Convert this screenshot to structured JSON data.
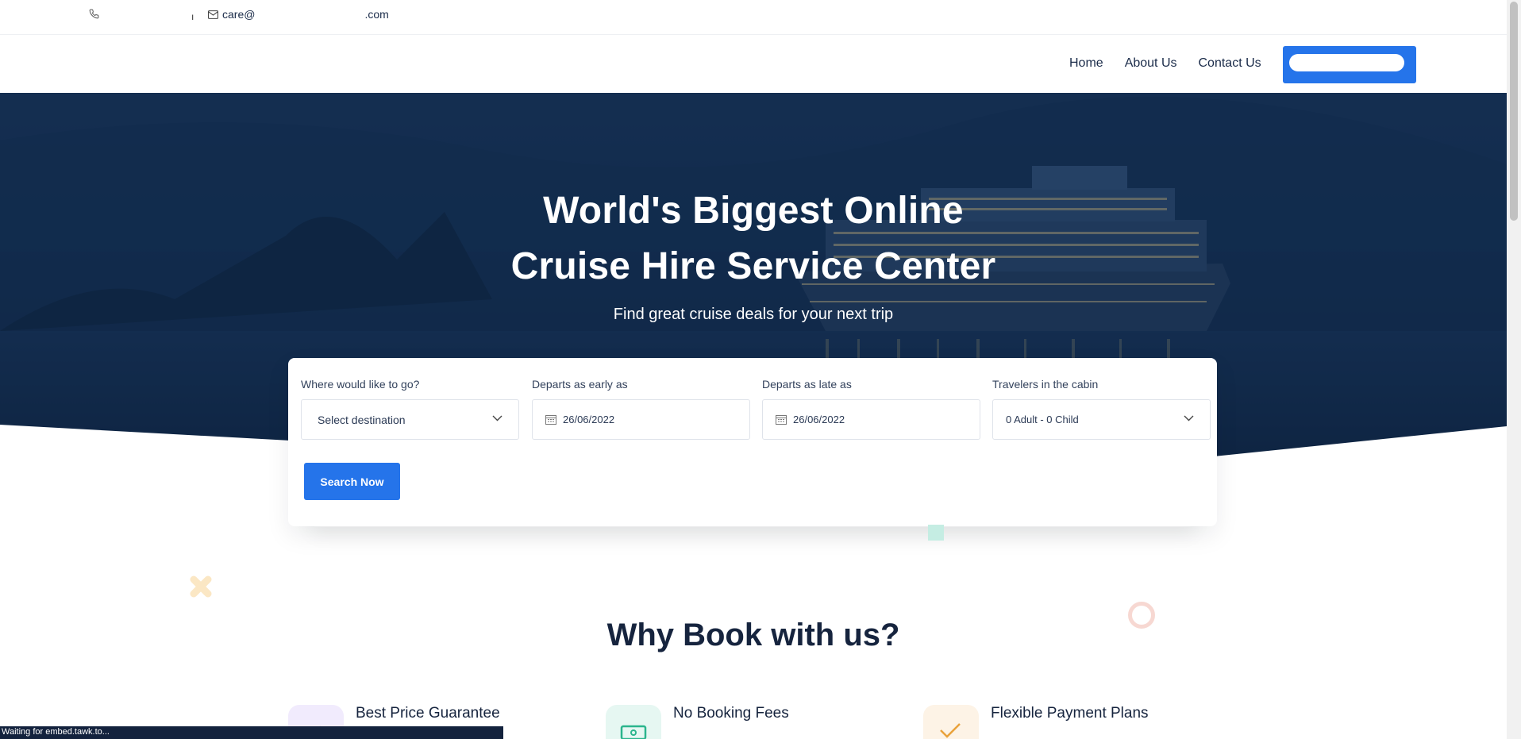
{
  "topbar": {
    "phone_text": "",
    "email_prefix": "care@",
    "email_suffix": ".com"
  },
  "nav": {
    "links": [
      "Home",
      "About Us",
      "Contact Us"
    ]
  },
  "hero": {
    "title_line1": "World's Biggest Online",
    "title_line2": "Cruise Hire Service Center",
    "subtitle": "Find great cruise deals for your next trip"
  },
  "search": {
    "destination_label": "Where would like to go?",
    "destination_value": "Select destination",
    "early_label": "Departs as early as",
    "early_value": "26/06/2022",
    "late_label": "Departs as late as",
    "late_value": "26/06/2022",
    "travelers_label": "Travelers in the cabin",
    "travelers_value": "0 Adult - 0 Child",
    "button": "Search Now"
  },
  "why": {
    "title": "Why Book with us?",
    "features": [
      {
        "title": "Best Price Guarantee",
        "icon": "tag-icon"
      },
      {
        "title": "No Booking Fees",
        "icon": "money-icon"
      },
      {
        "title": "Flexible Payment Plans",
        "icon": "check-icon"
      }
    ]
  },
  "status_text": "Waiting for embed.tawk.to...",
  "colors": {
    "accent": "#2574ea",
    "hero_bg": "#122a48",
    "heading": "#16243e"
  }
}
